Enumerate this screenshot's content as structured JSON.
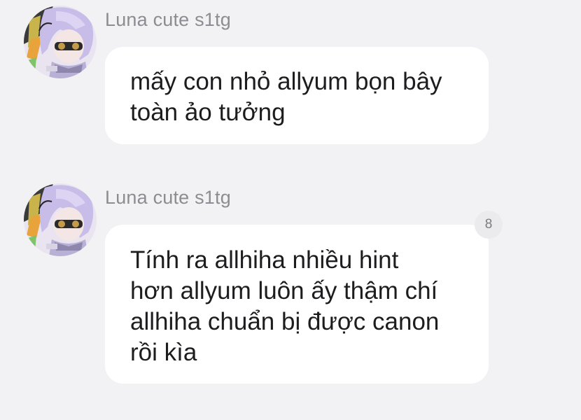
{
  "messages": [
    {
      "sender": "Luna cute s1tg",
      "text": "mấy con nhỏ allyum bọn bây\ntoàn ảo tưởng",
      "avatar_icon": "user-avatar-anime-icon"
    },
    {
      "sender": "Luna cute s1tg",
      "text": "Tính ra allhiha nhiều hint\nhơn allyum luôn ấy thậm chí\nallhiha chuẩn bị được canon\nrồi kìa",
      "reaction_count": "8",
      "avatar_icon": "user-avatar-anime-icon"
    }
  ],
  "colors": {
    "background": "#f2f2f4",
    "bubble": "#ffffff",
    "sender_name": "#8c8c92",
    "message_text": "#1d1d1f"
  }
}
